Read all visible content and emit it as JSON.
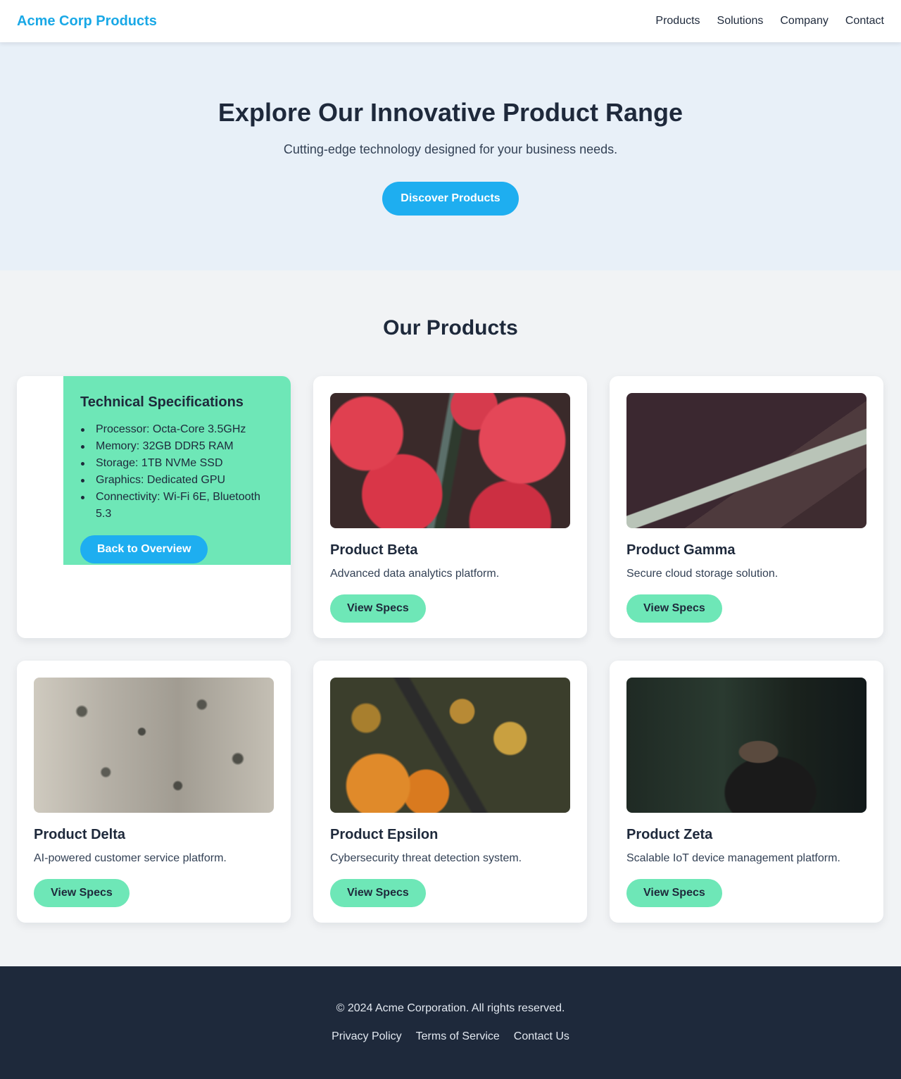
{
  "header": {
    "brand": "Acme Corp Products",
    "nav": [
      "Products",
      "Solutions",
      "Company",
      "Contact"
    ]
  },
  "hero": {
    "title": "Explore Our Innovative Product Range",
    "subtitle": "Cutting-edge technology designed for your business needs.",
    "cta_label": "Discover Products"
  },
  "products": {
    "heading": "Our Products",
    "specs_panel": {
      "title": "Technical Specifications",
      "items": [
        "Processor: Octa-Core 3.5GHz",
        "Memory: 32GB DDR5 RAM",
        "Storage: 1TB NVMe SSD",
        "Graphics: Dedicated GPU",
        "Connectivity: Wi-Fi 6E, Bluetooth 5.3"
      ],
      "back_label": "Back to Overview"
    },
    "cards": [
      {
        "name": "Product Beta",
        "description": "Advanced data analytics platform.",
        "button": "View Specs"
      },
      {
        "name": "Product Gamma",
        "description": "Secure cloud storage solution.",
        "button": "View Specs"
      },
      {
        "name": "Product Delta",
        "description": "AI-powered customer service platform.",
        "button": "View Specs"
      },
      {
        "name": "Product Epsilon",
        "description": "Cybersecurity threat detection system.",
        "button": "View Specs"
      },
      {
        "name": "Product Zeta",
        "description": "Scalable IoT device management platform.",
        "button": "View Specs"
      }
    ]
  },
  "footer": {
    "copyright": "© 2024 Acme Corporation. All rights reserved.",
    "links": [
      "Privacy Policy",
      "Terms of Service",
      "Contact Us"
    ]
  },
  "colors": {
    "accent": "#1eaef0",
    "brand": "#19a8e6",
    "specs_button": "#6ee7b7",
    "dark": "#1e293b",
    "hero_bg": "#e8f0f8"
  }
}
